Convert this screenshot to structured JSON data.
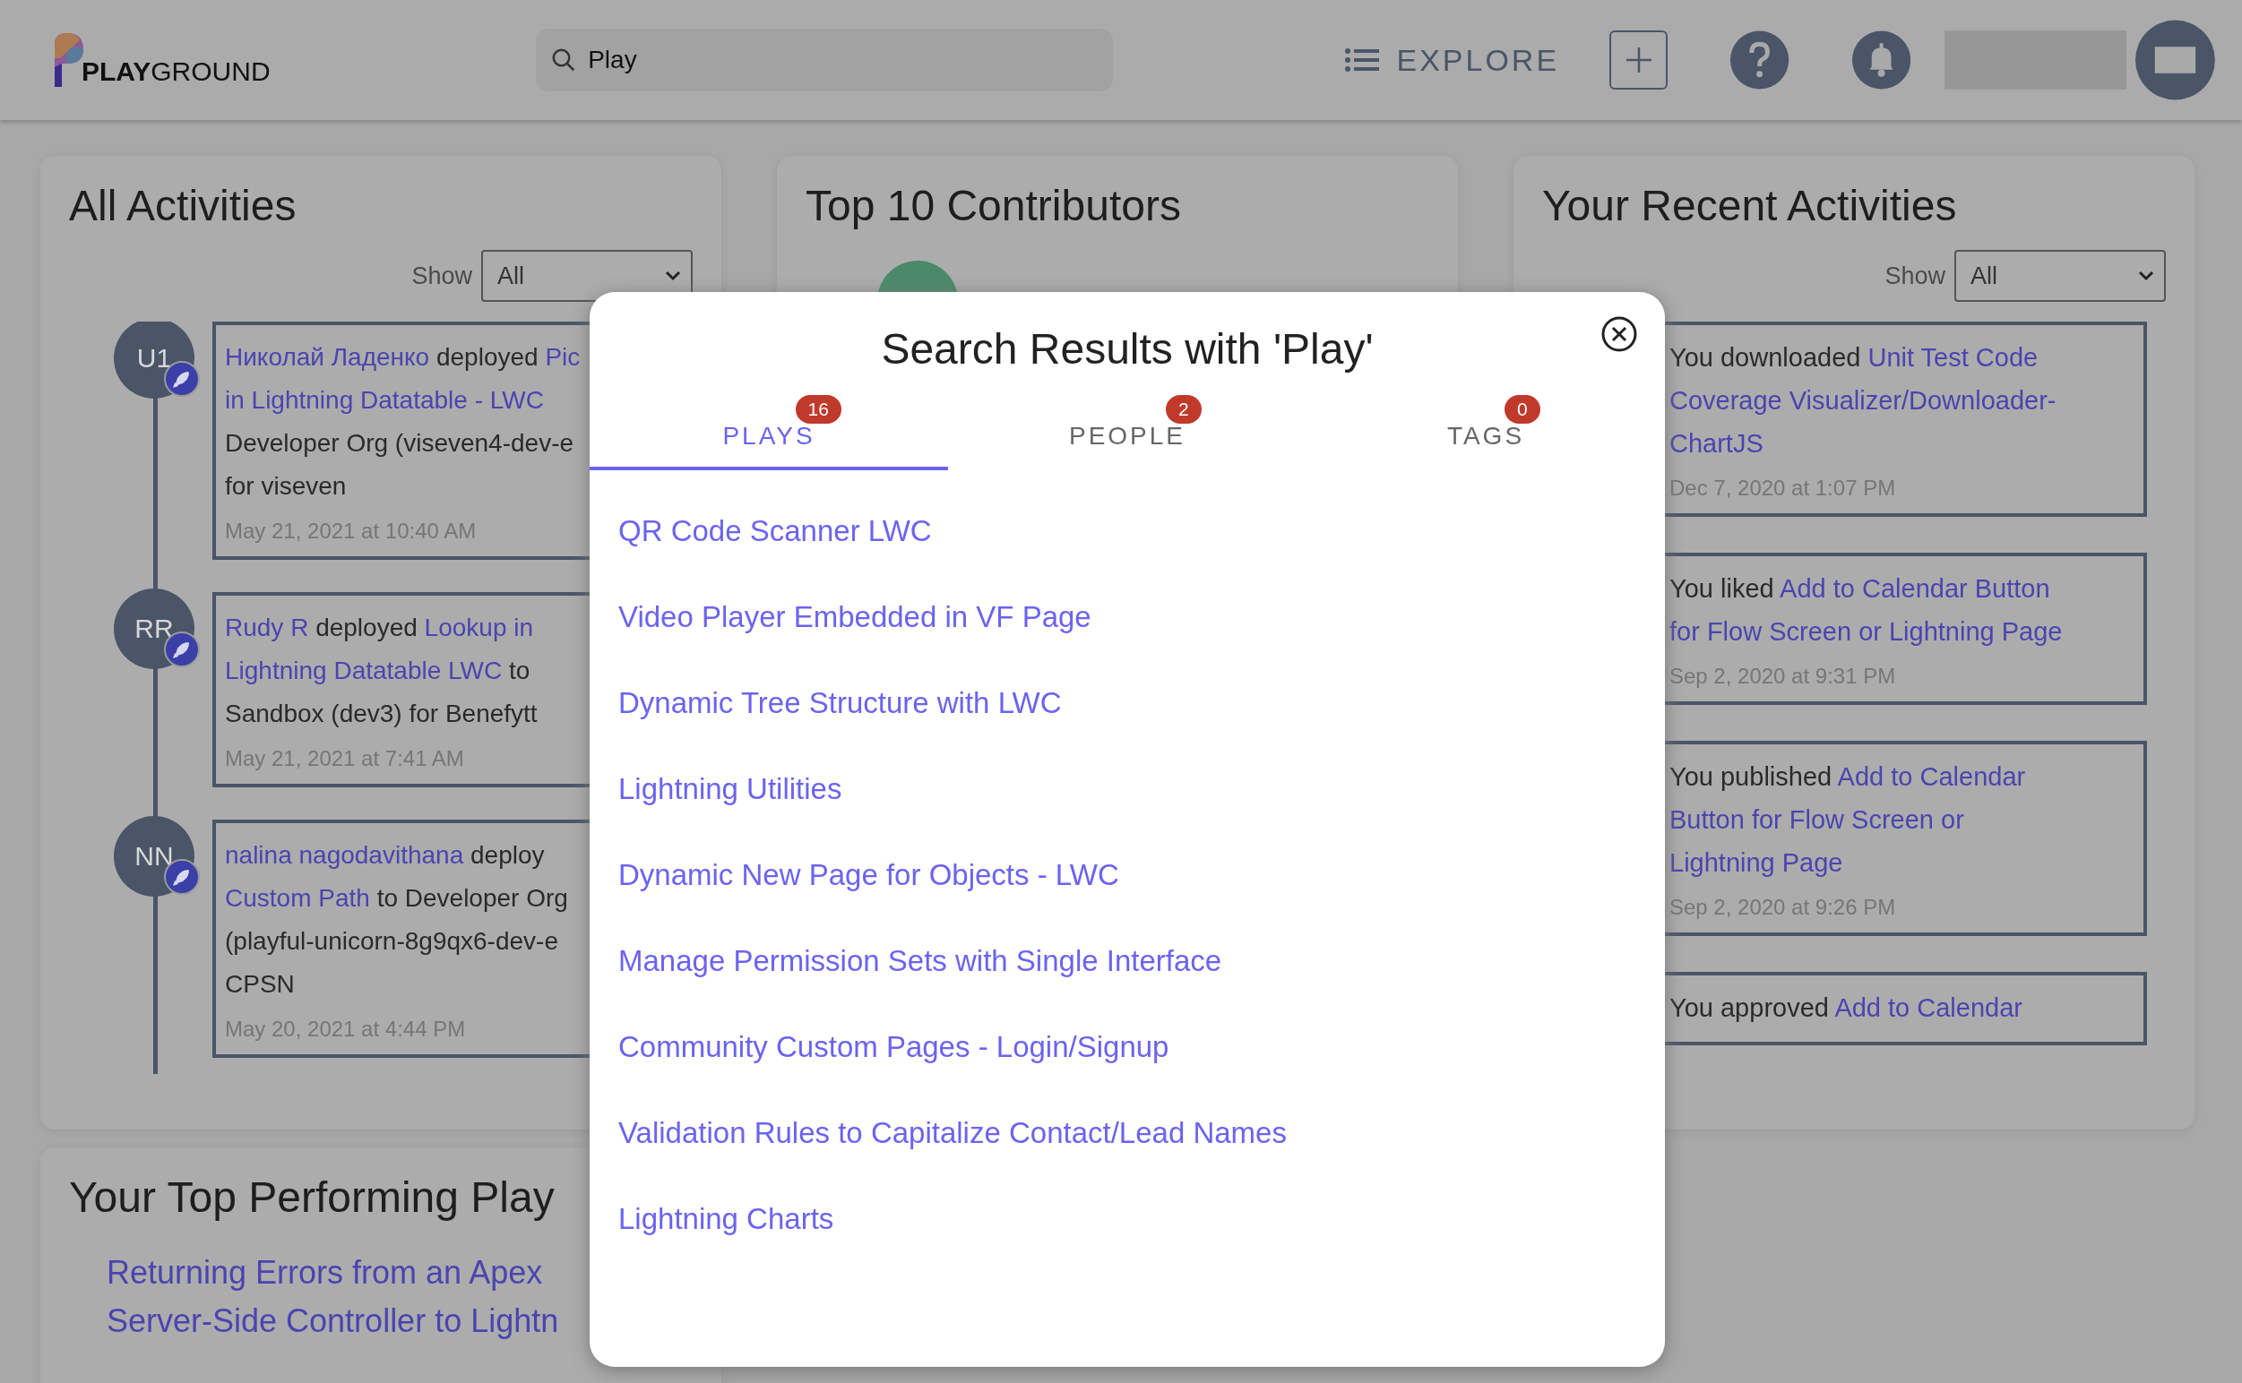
{
  "header": {
    "logo_text": "**PLAY**GROUND",
    "search": {
      "value": "Play"
    },
    "explore": "EXPLORE"
  },
  "cards": [
    {
      "title": "All Activities",
      "show_label": "Show",
      "show_value": "All",
      "activities": [
        {
          "initials": "U1",
          "segments": [
            {
              "text": "Николай Ладенко",
              "link": true
            },
            {
              "text": " deployed ",
              "link": false
            },
            {
              "text": "Pic\nin Lightning Datatable - LWC",
              "link": true
            },
            {
              "text": "\nDeveloper Org (viseven4-dev-e\nfor viseven",
              "link": false
            }
          ],
          "time": "May 21, 2021 at 10:40 AM"
        },
        {
          "initials": "RR",
          "segments": [
            {
              "text": "Rudy R",
              "link": true
            },
            {
              "text": " deployed ",
              "link": false
            },
            {
              "text": "Lookup in\nLightning Datatable LWC",
              "link": true
            },
            {
              "text": " to\nSandbox (dev3) for Benefytt",
              "link": false
            }
          ],
          "time": "May 21, 2021 at 7:41 AM"
        },
        {
          "initials": "NN",
          "segments": [
            {
              "text": "nalina nagodavithana",
              "link": true
            },
            {
              "text": " deploy\n",
              "link": false
            },
            {
              "text": "Custom Path",
              "link": true
            },
            {
              "text": " to Developer Org\n(playful-unicorn-8g9qx6-dev-e\nCPSN",
              "link": false
            }
          ],
          "time": "May 20, 2021 at 4:44 PM"
        }
      ]
    },
    {
      "title": "Top 10 Contributors"
    },
    {
      "title": "Your Recent Activities",
      "show_label": "Show",
      "show_value": "All",
      "activities": [
        {
          "segments": [
            {
              "text": "You downloaded ",
              "link": false
            },
            {
              "text": "Unit Test Code\nCoverage Visualizer/Downloader-\nChartJS",
              "link": true
            }
          ],
          "time": "Dec 7, 2020 at 1:07 PM"
        },
        {
          "segments": [
            {
              "text": "You liked ",
              "link": false
            },
            {
              "text": "Add to Calendar Button\nfor Flow Screen or Lightning Page",
              "link": true
            }
          ],
          "time": "Sep 2, 2020 at 9:31 PM"
        },
        {
          "segments": [
            {
              "text": "You published ",
              "link": false
            },
            {
              "text": "Add to Calendar\nButton for Flow Screen or\nLightning Page",
              "link": true
            }
          ],
          "time": "Sep 2, 2020 at 9:26 PM"
        },
        {
          "segments": [
            {
              "text": "You approved ",
              "link": false
            },
            {
              "text": "Add to Calendar",
              "link": true
            }
          ]
        }
      ]
    },
    {
      "title": "Your Top Performing Play",
      "links": [
        "Returning Errors from an Apex\nServer-Side Controller to Lightn"
      ]
    }
  ],
  "modal": {
    "title": "Search Results with 'Play'",
    "tabs": [
      {
        "label": "PLAYS",
        "count": "16",
        "selected": true
      },
      {
        "label": "PEOPLE",
        "count": "2",
        "selected": false
      },
      {
        "label": "TAGS",
        "count": "0",
        "selected": false
      }
    ],
    "results": [
      "QR Code Scanner LWC",
      "Video Player Embedded in VF Page",
      "Dynamic Tree Structure with LWC",
      "Lightning Utilities",
      "Dynamic New Page for Objects - LWC",
      "Manage Permission Sets with Single Interface",
      "Community Custom Pages - Login/Signup",
      "Validation Rules to Capitalize Contact/Lead Names",
      "Lightning Charts"
    ]
  }
}
